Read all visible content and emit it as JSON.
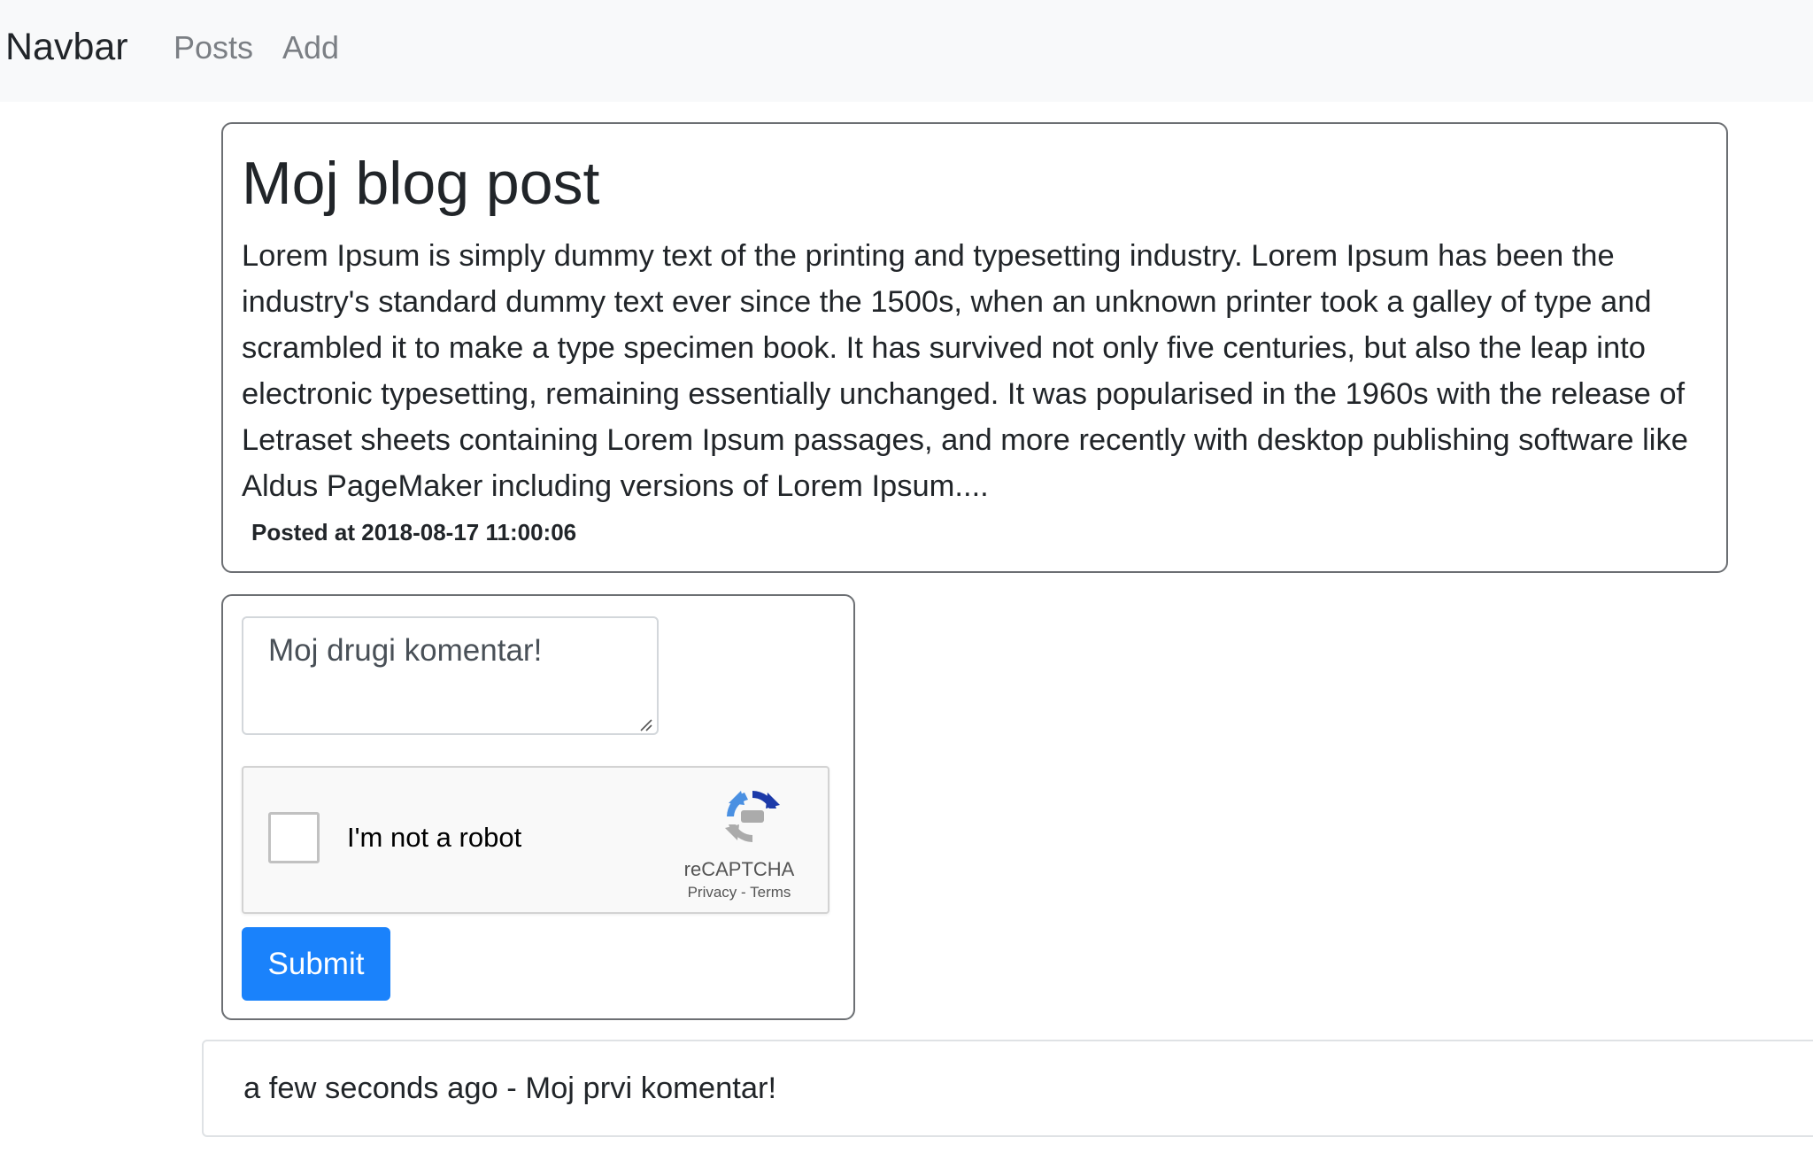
{
  "navbar": {
    "brand": "Navbar",
    "links": [
      "Posts",
      "Add"
    ]
  },
  "post": {
    "title": "Moj blog post",
    "body": "Lorem Ipsum is simply dummy text of the printing and typesetting industry. Lorem Ipsum has been the industry's standard dummy text ever since the 1500s, when an unknown printer took a galley of type and scrambled it to make a type specimen book. It has survived not only five centuries, but also the leap into electronic typesetting, remaining essentially unchanged. It was popularised in the 1960s with the release of Letraset sheets containing Lorem Ipsum passages, and more recently with desktop publishing software like Aldus PageMaker including versions of Lorem Ipsum....",
    "posted_at": "Posted at 2018-08-17 11:00:06"
  },
  "comment_form": {
    "textarea_value": "Moj drugi komentar!",
    "recaptcha": {
      "label": "I'm not a robot",
      "brand": "reCAPTCHA",
      "privacy": "Privacy",
      "separator": " - ",
      "terms": "Terms",
      "checked": false
    },
    "submit_label": "Submit"
  },
  "comments": [
    {
      "text": "a few seconds ago - Moj prvi komentar!"
    }
  ],
  "colors": {
    "navbar_bg": "#f8f9fa",
    "primary": "#1a82fb",
    "nav_link": "#7b7f84",
    "card_border": "#6c6f73"
  },
  "icons": {
    "recaptcha_logo": "recaptcha-logo-icon",
    "resize": "resize-grip-icon"
  }
}
